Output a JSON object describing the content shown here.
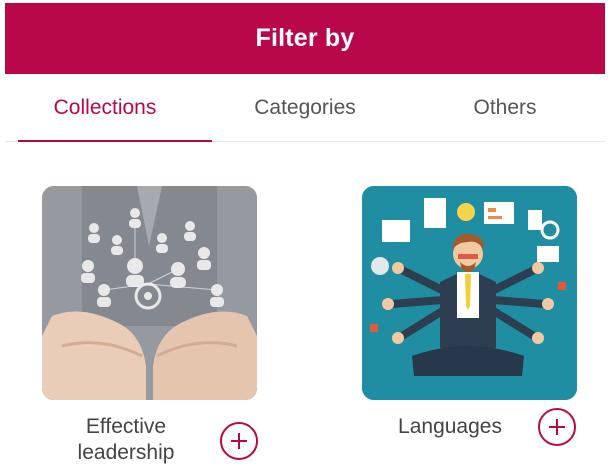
{
  "header": {
    "title": "Filter by"
  },
  "tabs": [
    {
      "label": "Collections",
      "active": true
    },
    {
      "label": "Categories",
      "active": false
    },
    {
      "label": "Others",
      "active": false
    }
  ],
  "cards": [
    {
      "title_line1": "Effective",
      "title_line2": "leadership",
      "image": "hands-holding-people-network-image"
    },
    {
      "title": "Languages",
      "image": "multitasking-businessman-illustration"
    }
  ],
  "colors": {
    "accent": "#b8084a",
    "teal": "#1f8ea3"
  },
  "icons": {
    "add": "plus-circle-icon"
  }
}
